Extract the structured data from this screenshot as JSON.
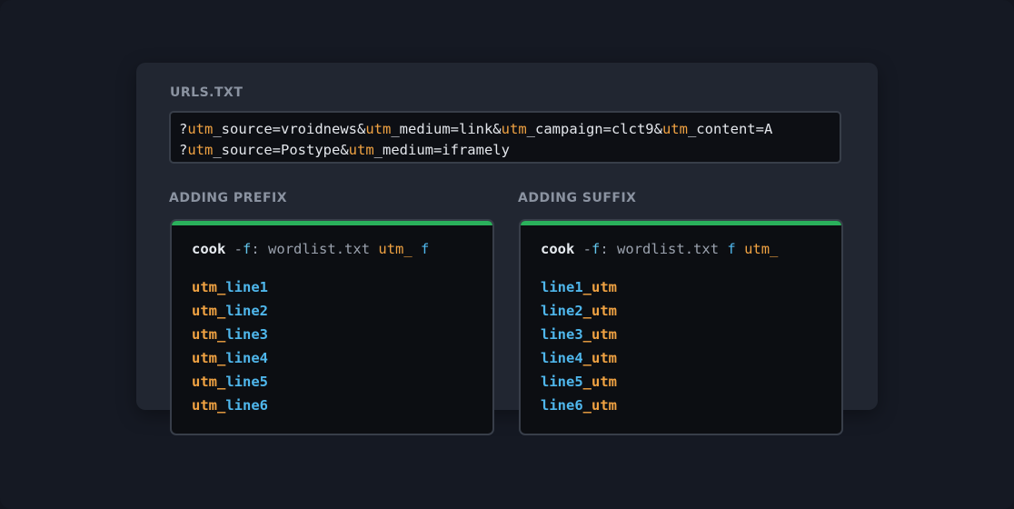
{
  "urls_label": "URLS.TXT",
  "url_lines": [
    [
      {
        "t": "?",
        "hl": false
      },
      {
        "t": "utm",
        "hl": true
      },
      {
        "t": "_source=vroidnews&",
        "hl": false
      },
      {
        "t": "utm",
        "hl": true
      },
      {
        "t": "_medium=link&",
        "hl": false
      },
      {
        "t": "utm",
        "hl": true
      },
      {
        "t": "_campaign=clct9&",
        "hl": false
      },
      {
        "t": "utm",
        "hl": true
      },
      {
        "t": "_content=A",
        "hl": false
      }
    ],
    [
      {
        "t": "?",
        "hl": false
      },
      {
        "t": "utm",
        "hl": true
      },
      {
        "t": "_source=Postype&",
        "hl": false
      },
      {
        "t": "utm",
        "hl": true
      },
      {
        "t": "_medium=iframely",
        "hl": false
      }
    ]
  ],
  "prefix": {
    "label": "ADDING PREFIX",
    "cmd": {
      "kw": "cook",
      "flag_dash": "-",
      "flag": "f",
      "colon": ":",
      "file": "wordlist.txt",
      "a": "utm_",
      "b": "f"
    },
    "lines": [
      {
        "utm": "utm_",
        "word": "line1"
      },
      {
        "utm": "utm_",
        "word": "line2"
      },
      {
        "utm": "utm_",
        "word": "line3"
      },
      {
        "utm": "utm_",
        "word": "line4"
      },
      {
        "utm": "utm_",
        "word": "line5"
      },
      {
        "utm": "utm_",
        "word": "line6"
      }
    ]
  },
  "suffix": {
    "label": "ADDING SUFFIX",
    "cmd": {
      "kw": "cook",
      "flag_dash": "-",
      "flag": "f",
      "colon": ":",
      "file": "wordlist.txt",
      "a": "f",
      "b": "utm_"
    },
    "lines": [
      {
        "word": "line1",
        "utm": "_utm"
      },
      {
        "word": "line2",
        "utm": "_utm"
      },
      {
        "word": "line3",
        "utm": "_utm"
      },
      {
        "word": "line4",
        "utm": "_utm"
      },
      {
        "word": "line5",
        "utm": "_utm"
      },
      {
        "word": "line6",
        "utm": "_utm"
      }
    ]
  },
  "colors": {
    "accent_green": "#2ab05b",
    "orange": "#f0a242",
    "blue": "#4fb7ec"
  }
}
